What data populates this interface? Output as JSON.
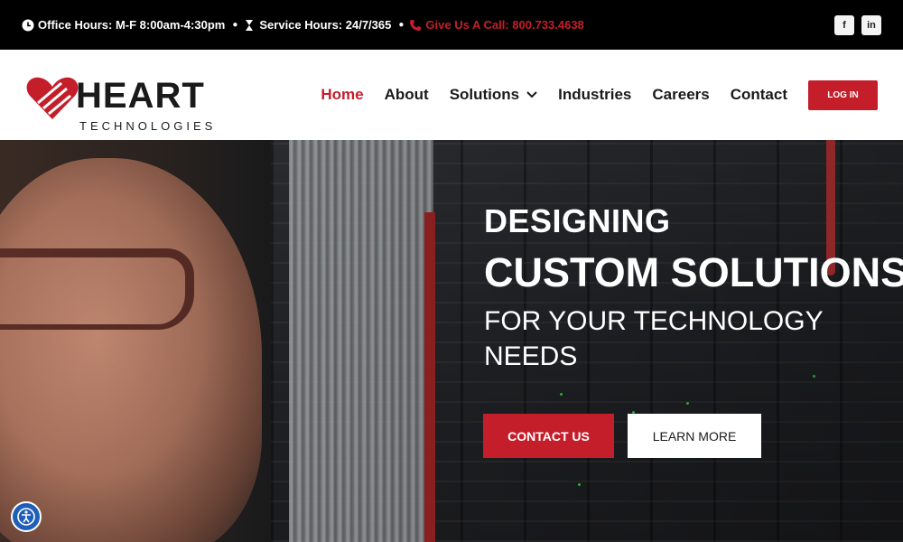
{
  "topbar": {
    "office_hours": "Office Hours: M-F 8:00am-4:30pm",
    "service_hours": "Service Hours: 24/7/365",
    "call": "Give Us A Call: 800.733.4638",
    "social": [
      "f",
      "in"
    ]
  },
  "logo": {
    "word": "HEART",
    "sub": "TECHNOLOGIES"
  },
  "nav": {
    "items": [
      "Home",
      "About",
      "Solutions",
      "Industries",
      "Careers",
      "Contact"
    ],
    "login": "LOG IN"
  },
  "hero": {
    "line1": "DESIGNING",
    "line2": "CUSTOM SOLUTIONS",
    "line3": "FOR YOUR TECHNOLOGY NEEDS",
    "contact_button": "CONTACT US",
    "learn_button": "LEARN MORE"
  },
  "colors": {
    "brand_red": "#c41e2b",
    "topbar_bg": "#000000",
    "accessibility_blue": "#1f5fb8"
  },
  "icons": [
    "clock-icon",
    "hourglass-icon",
    "phone-icon",
    "facebook-icon",
    "linkedin-icon",
    "chevron-down-icon",
    "heart-logo-icon",
    "accessibility-icon"
  ]
}
